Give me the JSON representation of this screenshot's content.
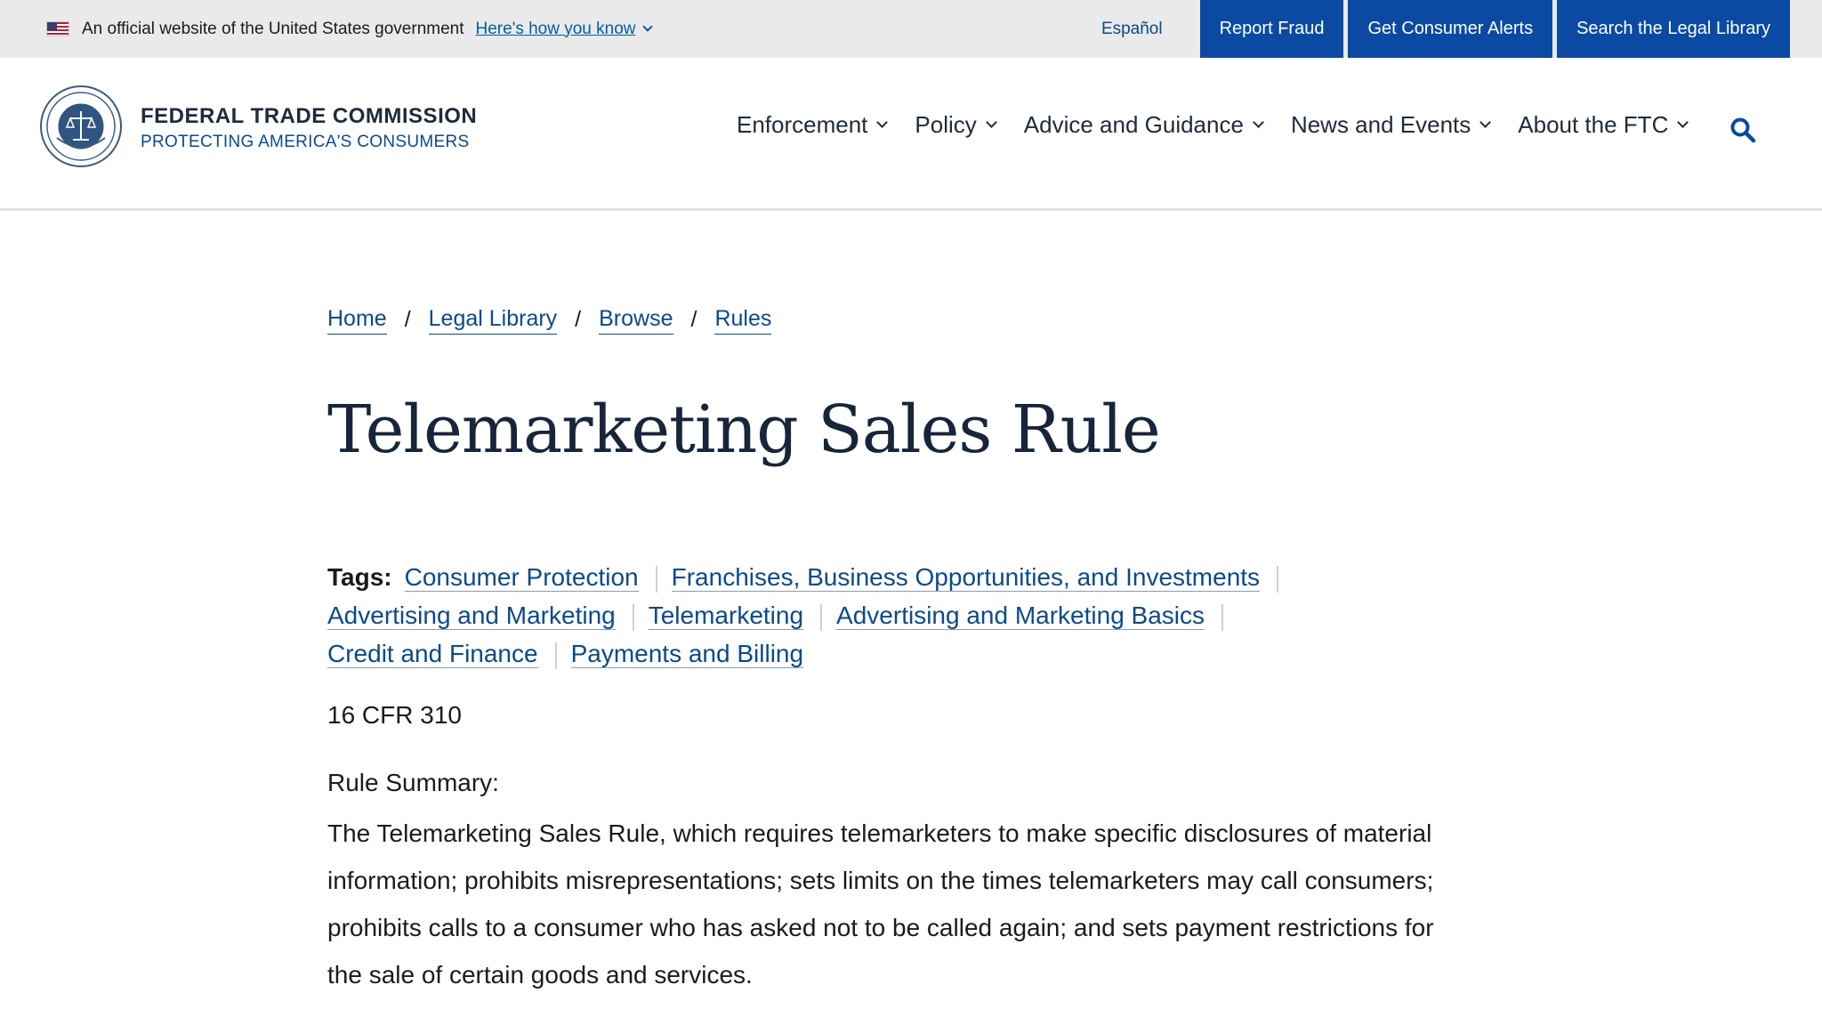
{
  "gov_banner": {
    "official_text": "An official website of the United States government",
    "how_link": "Here's how you know",
    "flag_icon": "us-flag-icon"
  },
  "top_links": {
    "espanol": "Español",
    "report_fraud": "Report Fraud",
    "consumer_alerts": "Get Consumer Alerts",
    "legal_library": "Search the Legal Library"
  },
  "brand": {
    "title": "FEDERAL TRADE COMMISSION",
    "subtitle": "PROTECTING AMERICA'S CONSUMERS",
    "seal_icon": "ftc-seal-icon"
  },
  "nav": {
    "items": [
      {
        "label": "Enforcement"
      },
      {
        "label": "Policy"
      },
      {
        "label": "Advice and Guidance"
      },
      {
        "label": "News and Events"
      },
      {
        "label": "About the FTC"
      }
    ],
    "search_icon": "search-icon"
  },
  "breadcrumb": [
    "Home",
    "Legal Library",
    "Browse",
    "Rules"
  ],
  "page": {
    "title": "Telemarketing Sales Rule",
    "tags_label": "Tags:",
    "tags": [
      "Consumer Protection",
      "Franchises, Business Opportunities, and Investments",
      "Advertising and Marketing",
      "Telemarketing",
      "Advertising and Marketing Basics",
      "Credit and Finance",
      "Payments and Billing"
    ],
    "cfr": "16 CFR 310",
    "summary_label": "Rule Summary:",
    "summary_lines": [
      "The Telemarketing Sales Rule, which requires telemarketers to make specific disclosures of material",
      "information; prohibits misrepresentations; sets limits on the times telemarketers may call consumers;",
      "prohibits calls to a consumer who has asked not to be called again; and sets payment restrictions for",
      "the sale of certain goods and services."
    ]
  },
  "colors": {
    "link": "#0a4a8a",
    "top_button": "#0b4aa2",
    "banner_bg": "#eaeaea",
    "title": "#17253a"
  }
}
